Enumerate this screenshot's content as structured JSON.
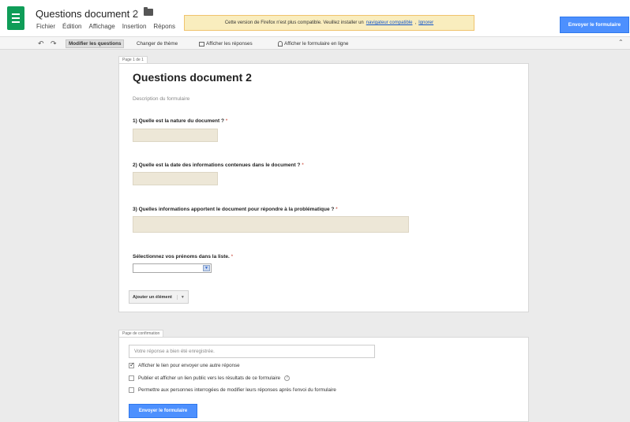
{
  "header": {
    "doc_title": "Questions document 2",
    "menu": [
      "Fichier",
      "Édition",
      "Affichage",
      "Insertion",
      "Répons"
    ],
    "notice": {
      "text": "Cette version de Firefox n'est plus compatible. Veuillez installer un",
      "link": "navigateur compatible",
      "dismiss": "Ignorer"
    },
    "send_button": "Envoyer le formulaire"
  },
  "toolbar": {
    "edit_questions": "Modifier les questions",
    "change_theme": "Changer de thème",
    "show_responses": "Afficher les réponses",
    "show_live": "Afficher le formulaire en ligne"
  },
  "form": {
    "page_tab": "Page 1 de 1",
    "title": "Questions document 2",
    "description": "Description du formulaire",
    "questions": [
      {
        "label": "1) Quelle est la nature du document ?",
        "required": "*"
      },
      {
        "label": "2) Quelle est la date des informations contenues dans le document ?",
        "required": "*"
      },
      {
        "label": "3) Quelles informations apportent le document pour répondre à la problématique ?",
        "required": "*"
      },
      {
        "label": "Sélectionnez vos prénoms dans la liste.",
        "required": "*"
      }
    ],
    "add_item": "Ajouter un élément"
  },
  "confirmation": {
    "tab": "Page de confirmation",
    "message_placeholder": "Votre réponse a bien été enregistrée.",
    "options": [
      {
        "label": "Afficher le lien pour envoyer une autre réponse",
        "checked": true
      },
      {
        "label": "Publier et afficher un lien public vers les résultats de ce formulaire",
        "checked": false
      },
      {
        "label": "Permettre aux personnes interrogées de modifier leurs réponses après l'envoi du formulaire",
        "checked": false
      }
    ],
    "send_button": "Envoyer le formulaire"
  },
  "colors": {
    "brand_green": "#0f9d58",
    "accent_blue": "#4d90fe",
    "notice_yellow": "#f9edbe",
    "field_beige": "#ede7d7"
  }
}
